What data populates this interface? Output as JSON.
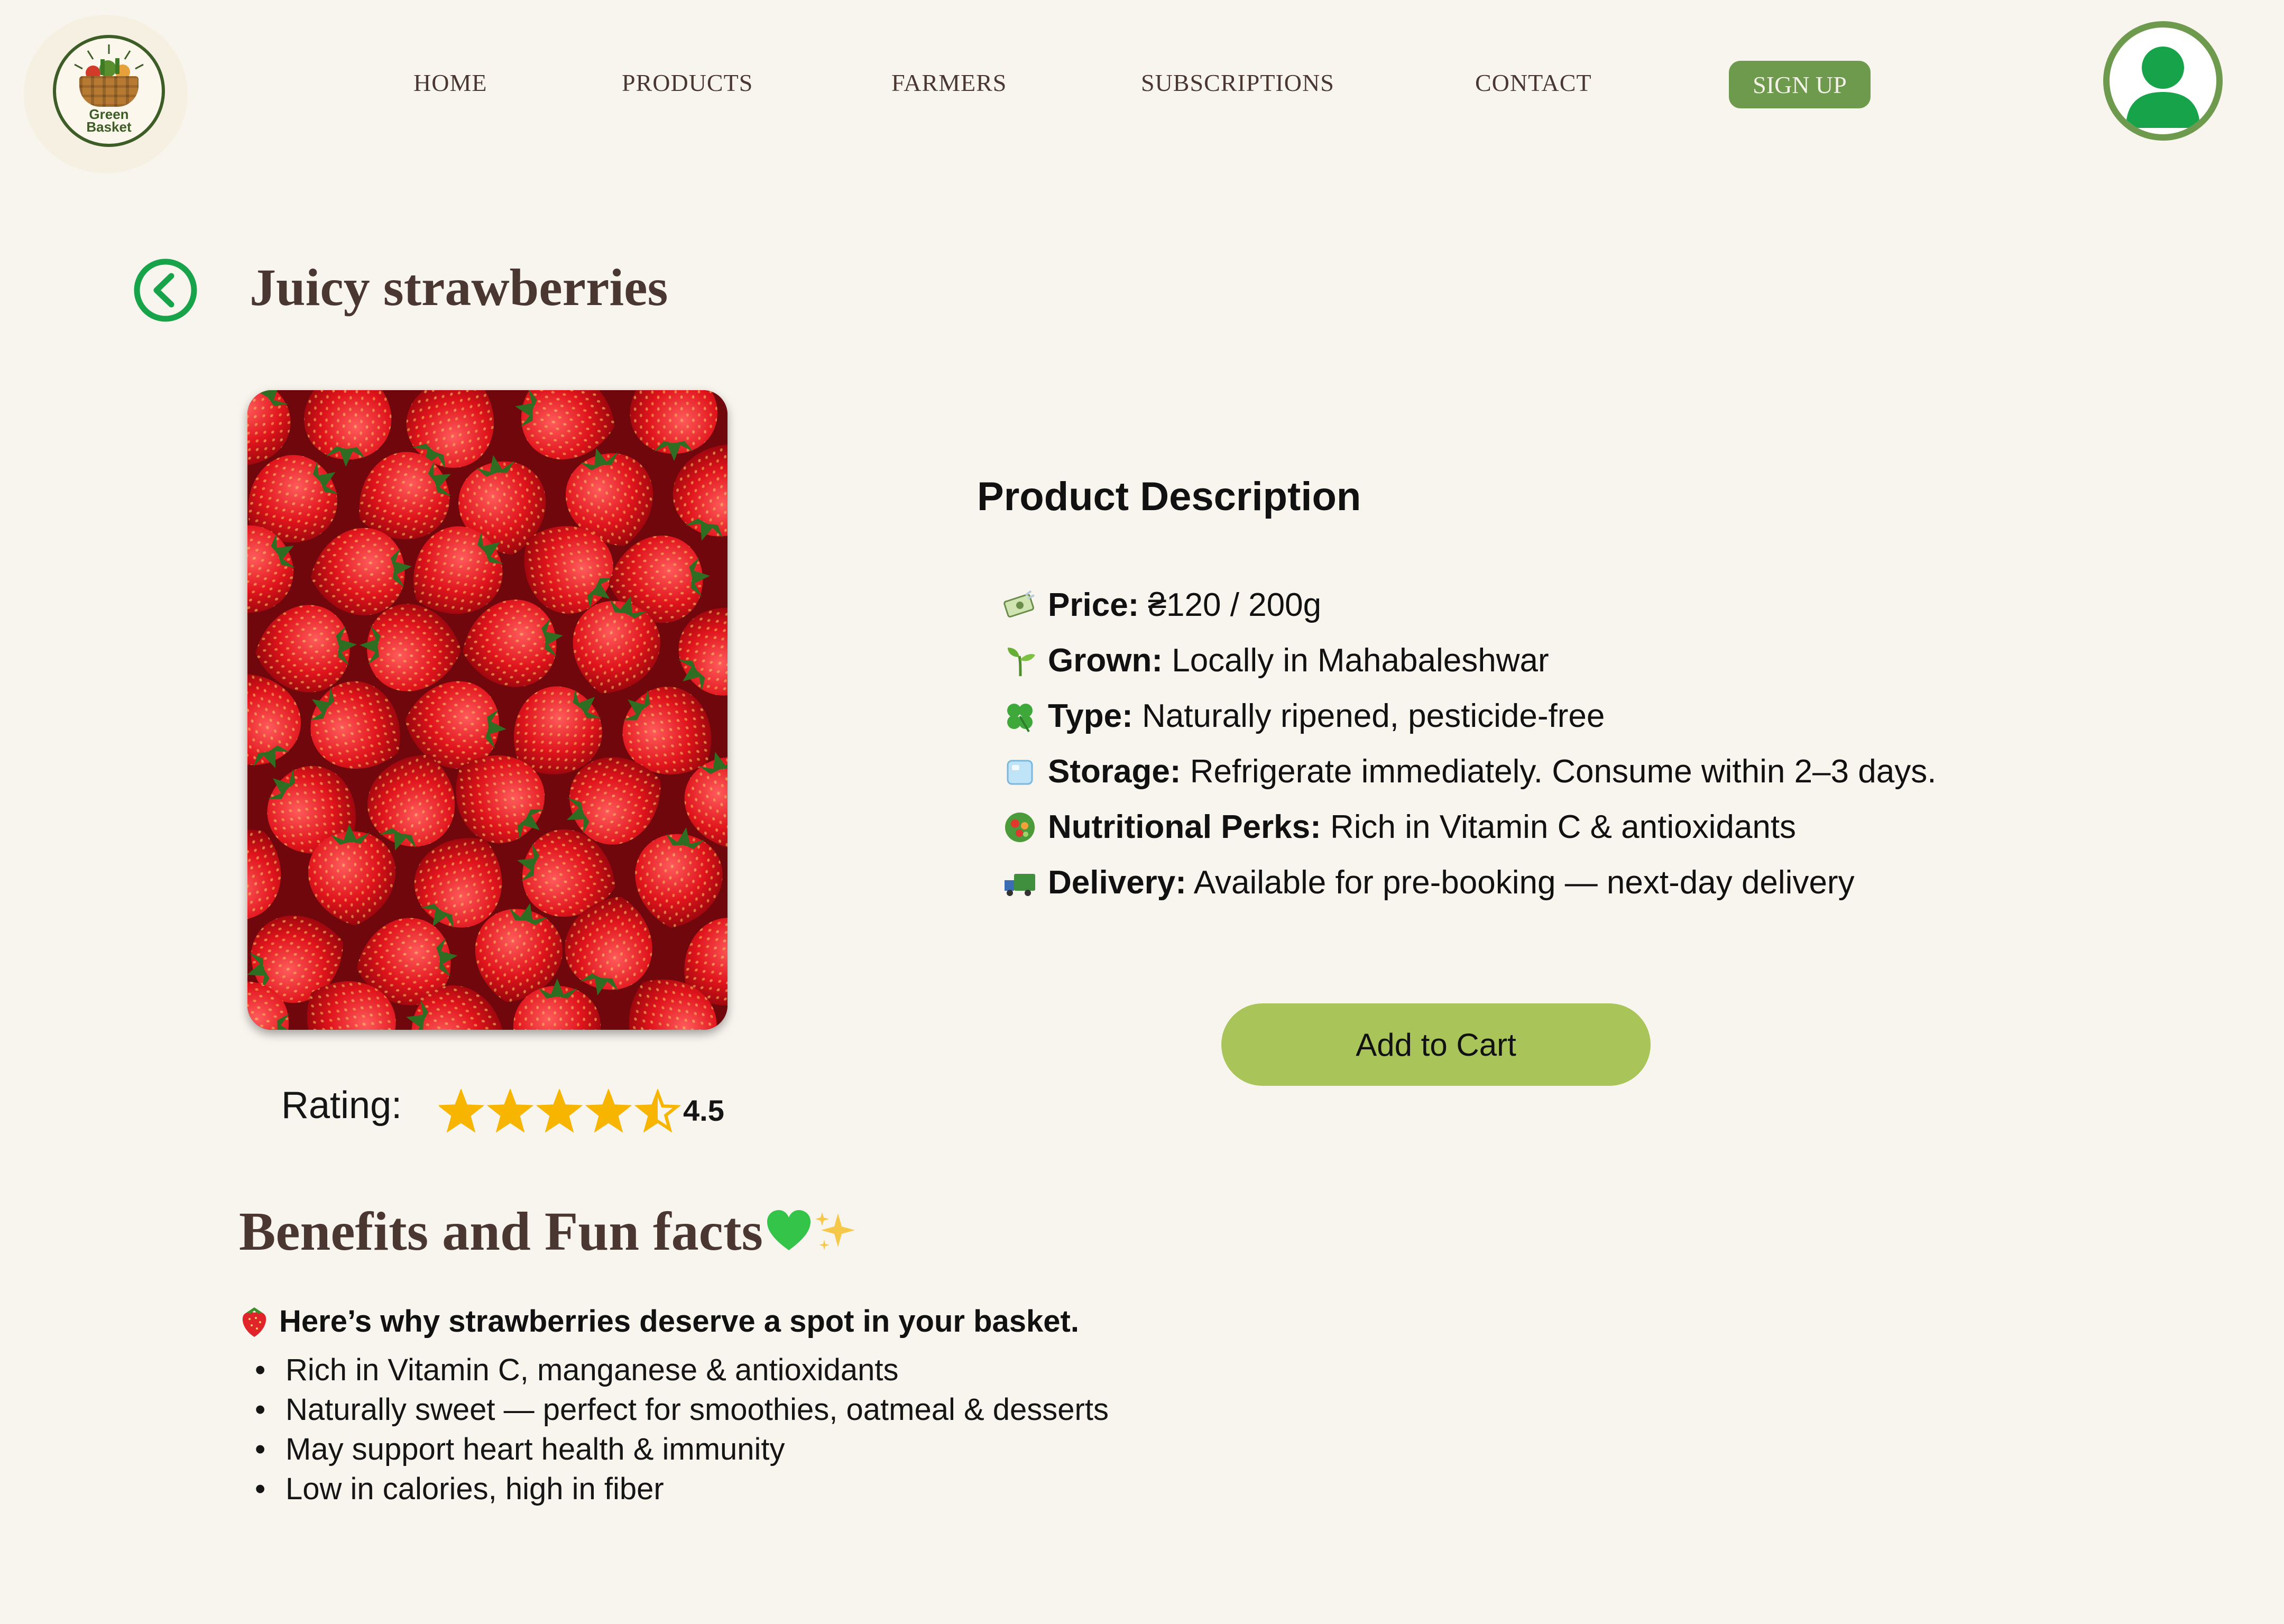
{
  "brand": {
    "line1": "Green",
    "line2": "Basket"
  },
  "nav": {
    "items": [
      "HOME",
      "PRODUCTS",
      "FARMERS",
      "SUBSCRIPTIONS",
      "CONTACT"
    ],
    "signup": "SIGN UP"
  },
  "product": {
    "title": "Juicy strawberries",
    "rating_label": "Rating:",
    "rating": 4.5,
    "rating_text": "4.5",
    "rating_max": 5
  },
  "description": {
    "heading": "Product Description",
    "rows": [
      {
        "icon": "money-icon",
        "label": "Price:",
        "value": " ₴120 / 200g"
      },
      {
        "icon": "seedling-icon",
        "label": "Grown:",
        "value": " Locally in Mahabaleshwar"
      },
      {
        "icon": "clover-icon",
        "label": "Type:",
        "value": " Naturally ripened, pesticide-free"
      },
      {
        "icon": "ice-icon",
        "label": "Storage:",
        "value": " Refrigerate immediately. Consume within 2–3 days."
      },
      {
        "icon": "salad-icon",
        "label": "Nutritional Perks:",
        "value": " Rich in Vitamin C & antioxidants"
      },
      {
        "icon": "truck-icon",
        "label": "Delivery:",
        "value": " Available for pre-booking — next-day delivery"
      }
    ],
    "cart_button": "Add to Cart"
  },
  "benefits": {
    "heading": "Benefits and Fun facts",
    "intro": "Here’s why strawberries deserve a spot in your basket.",
    "points": [
      "Rich in Vitamin C, manganese & antioxidants",
      "Naturally sweet — perfect for smoothies, oatmeal & desserts",
      "May support heart health & immunity",
      "Low in calories, high in fiber"
    ]
  },
  "colors": {
    "background": "#f8f5ee",
    "accent_green": "#6e9a4e",
    "cart_green": "#a9c55a",
    "back_green": "#17a34a",
    "star": "#f7b500",
    "heading_brown": "#4a3732"
  }
}
